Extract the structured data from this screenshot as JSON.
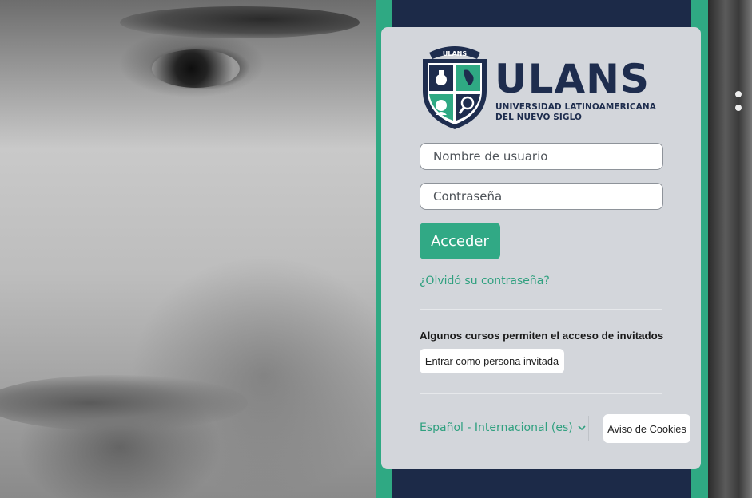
{
  "brand": {
    "shield_label": "ULANS",
    "wordmark": "ULANS",
    "subtitle_line1": "UNIVERSIDAD LATINOAMERICANA",
    "subtitle_line2": "DEL NUEVO SIGLO",
    "navy": "#1c2a48",
    "green": "#2fa983"
  },
  "login": {
    "username_placeholder": "Nombre de usuario",
    "username_value": "",
    "password_placeholder": "Contraseña",
    "password_value": "",
    "submit_label": "Acceder",
    "forgot_link": "¿Olvidó su contraseña?"
  },
  "guest": {
    "heading": "Algunos cursos permiten el acceso de invitados",
    "button_label": "Entrar como persona invitada"
  },
  "footer": {
    "language_selected": "Español - Internacional (es)",
    "language_icon": "chevron-down-icon",
    "cookies_button": "Aviso de Cookies"
  }
}
